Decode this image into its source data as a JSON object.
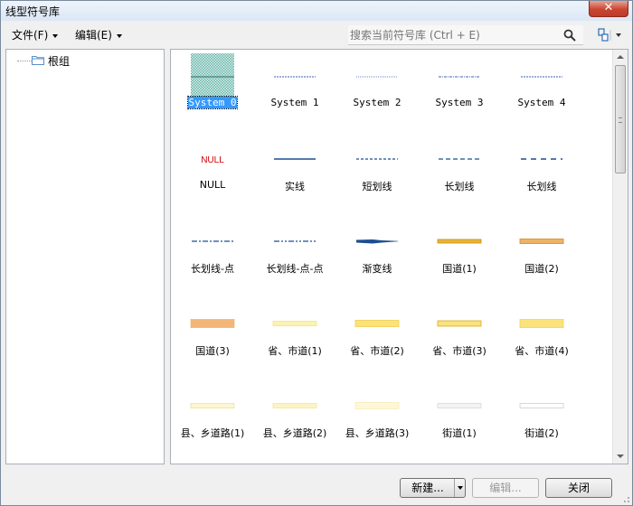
{
  "window": {
    "title": "线型符号库",
    "close_glyph": "✕"
  },
  "menubar": {
    "items": [
      {
        "label": "文件(F)"
      },
      {
        "label": "编辑(E)"
      }
    ]
  },
  "search": {
    "placeholder": "搜索当前符号库 (Ctrl + E)",
    "icon": "search-icon"
  },
  "view_toggle": {
    "icon": "view-mode-icon"
  },
  "tree": {
    "root": {
      "label": "根组",
      "icon": "folder-icon"
    }
  },
  "symbols": [
    {
      "label": "System 0",
      "style": "hatch",
      "selected": true
    },
    {
      "label": "System 1",
      "style": "dashed-fine",
      "color": "#3a5fb0"
    },
    {
      "label": "System 2",
      "style": "dotted-fine",
      "color": "#6b86c9"
    },
    {
      "label": "System 3",
      "style": "dashdot-fine",
      "color": "#3a5fb0"
    },
    {
      "label": "System 4",
      "style": "dashed-fine",
      "color": "#3a5fb0"
    },
    {
      "label": "NULL",
      "style": "null-text",
      "color": "#d00000"
    },
    {
      "label": "实线",
      "style": "solid",
      "color": "#1c4e8f"
    },
    {
      "label": "短划线",
      "style": "short-dash",
      "color": "#1c4e8f"
    },
    {
      "label": "长划线",
      "style": "long-dash",
      "color": "#1c4e8f"
    },
    {
      "label": "长划线",
      "style": "long-dash-wide",
      "color": "#1c4e8f"
    },
    {
      "label": "长划线-点",
      "style": "dash-dot",
      "color": "#1c4e8f"
    },
    {
      "label": "长划线-点-点",
      "style": "dash-dot-dot",
      "color": "#1c4e8f"
    },
    {
      "label": "渐变线",
      "style": "gradient",
      "color": "#1c4e8f"
    },
    {
      "label": "国道(1)",
      "style": "band",
      "color": "#e8b43a",
      "edge": "#c88d10",
      "h": 4
    },
    {
      "label": "国道(2)",
      "style": "band",
      "color": "#eeb366",
      "edge": "#d0862a",
      "h": 5
    },
    {
      "label": "国道(3)",
      "style": "band",
      "color": "#f2b679",
      "edge": "#f2b679",
      "h": 9
    },
    {
      "label": "省、市道(1)",
      "style": "band",
      "color": "#fbf3b0",
      "edge": "#f3e487",
      "h": 5
    },
    {
      "label": "省、市道(2)",
      "style": "band",
      "color": "#fbe27a",
      "edge": "#f0cf4d",
      "h": 7
    },
    {
      "label": "省、市道(3)",
      "style": "band",
      "color": "#fbe27a",
      "edge": "#d9a72a",
      "h": 6
    },
    {
      "label": "省、市道(4)",
      "style": "band",
      "color": "#fbe27a",
      "edge": "#f5d34f",
      "h": 9
    },
    {
      "label": "县、乡道路(1)",
      "style": "band",
      "color": "#fdf6cf",
      "edge": "#f0e0a0",
      "h": 5
    },
    {
      "label": "县、乡道路(2)",
      "style": "band",
      "color": "#fdf4c4",
      "edge": "#f5e59a",
      "h": 5
    },
    {
      "label": "县、乡道路(3)",
      "style": "band",
      "color": "#fef8d8",
      "edge": "#f8ecb8",
      "h": 7
    },
    {
      "label": "街道(1)",
      "style": "band",
      "color": "#f4f4f4",
      "edge": "#d8d8d8",
      "h": 5
    },
    {
      "label": "街道(2)",
      "style": "band",
      "color": "#ffffff",
      "edge": "#cfcfcf",
      "h": 5
    }
  ],
  "buttons": {
    "new_label": "新建...",
    "edit_label": "编辑...",
    "close_label": "关闭"
  }
}
